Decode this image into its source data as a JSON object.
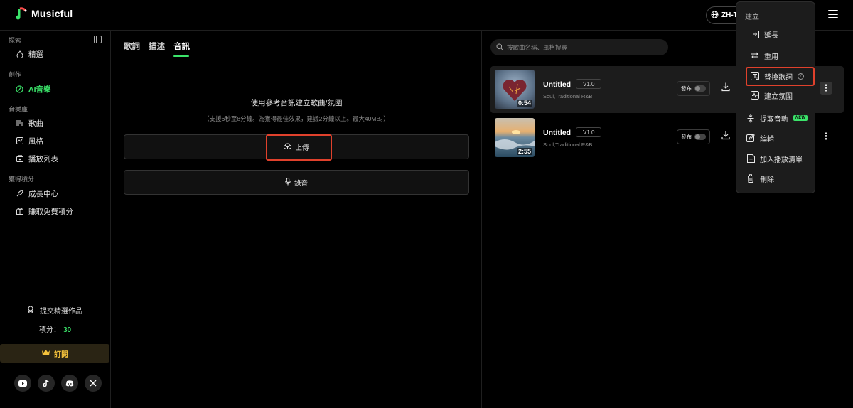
{
  "app": {
    "name": "Musicful"
  },
  "header": {
    "language": "ZH-T"
  },
  "sidebar": {
    "sections": [
      {
        "label": "探索",
        "items": [
          {
            "label": "精選",
            "icon": "flame-icon"
          }
        ]
      },
      {
        "label": "創作",
        "items": [
          {
            "label": "AI音樂",
            "icon": "music-note-icon",
            "active": true
          }
        ]
      },
      {
        "label": "音樂庫",
        "items": [
          {
            "label": "歌曲",
            "icon": "music-list-icon"
          },
          {
            "label": "風格",
            "icon": "style-icon"
          },
          {
            "label": "播放列表",
            "icon": "playlist-icon"
          }
        ]
      },
      {
        "label": "獲得積分",
        "items": [
          {
            "label": "成長中心",
            "icon": "rocket-icon"
          },
          {
            "label": "賺取免費積分",
            "icon": "gift-icon"
          }
        ]
      }
    ],
    "submit_work": "提交精選作品",
    "points_label": "積分：",
    "points_value": "30",
    "subscribe": "訂閱",
    "socials": [
      "youtube-icon",
      "tiktok-icon",
      "discord-icon",
      "x-icon"
    ]
  },
  "create": {
    "tabs": [
      {
        "label": "歌詞"
      },
      {
        "label": "描述"
      },
      {
        "label": "音訊",
        "active": true
      }
    ],
    "title": "使用參考音訊建立歌曲/氛圍",
    "note": "（支援6秒至8分鐘。為獲得最佳效果，建議2分鐘以上。最大40MB。）",
    "upload_label": "上傳",
    "record_label": "錄音"
  },
  "library": {
    "search_placeholder": "按歌曲名稱、風格搜尋",
    "songs": [
      {
        "title": "Untitled",
        "version": "V1.0",
        "tags": "Soul,Traditional R&B",
        "duration": "0:54",
        "publish_label": "發布",
        "selected": true
      },
      {
        "title": "Untitled",
        "version": "V1.0",
        "tags": "Soul,Traditional R&B",
        "duration": "2:55",
        "publish_label": "發布",
        "selected": false
      }
    ]
  },
  "context_menu": {
    "header": "建立",
    "items": [
      {
        "label": "延長",
        "icon": "extend-icon",
        "sub": true
      },
      {
        "label": "重用",
        "icon": "reuse-icon",
        "sub": true
      },
      {
        "label": "替換歌詞",
        "icon": "replace-lyrics-icon",
        "sub": true,
        "highlighted": true,
        "help": "?"
      },
      {
        "label": "建立氛圍",
        "icon": "vibe-icon",
        "sub": true
      },
      {
        "label": "提取音軌",
        "icon": "extract-icon",
        "badge": "NEW"
      },
      {
        "label": "編輯",
        "icon": "edit-icon"
      },
      {
        "label": "加入播放清單",
        "icon": "add-playlist-icon"
      },
      {
        "label": "刪除",
        "icon": "trash-icon"
      }
    ]
  },
  "colors": {
    "accent": "#3be46a",
    "highlight": "#e0412c",
    "gold": "#f4c23c"
  }
}
